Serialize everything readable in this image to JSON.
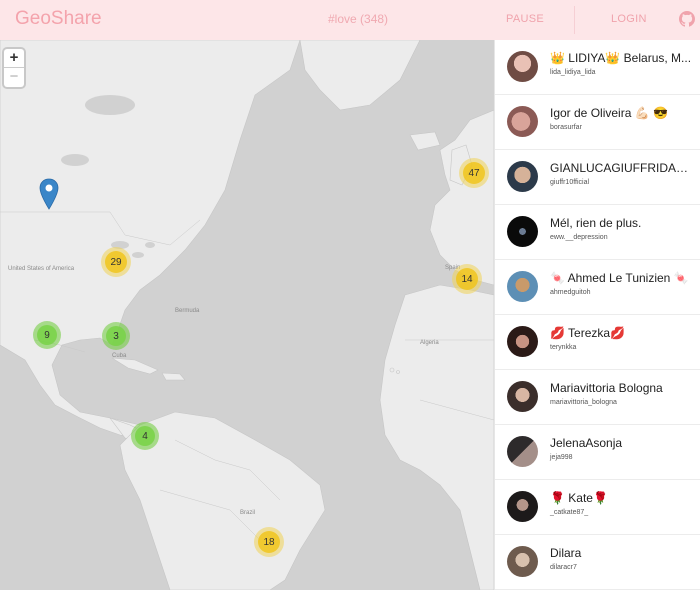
{
  "app": {
    "title": "GeoShare"
  },
  "header": {
    "tag": "#love (348)",
    "pause_label": "PAUSE",
    "login_label": "LOGIN",
    "github_icon": "github-icon"
  },
  "map": {
    "zoom_in": "+",
    "zoom_out": "−",
    "clusters": [
      {
        "count": "47",
        "color": "yellow"
      },
      {
        "count": "29",
        "color": "yellow"
      },
      {
        "count": "14",
        "color": "yellow"
      },
      {
        "count": "18",
        "color": "yellow"
      },
      {
        "count": "9",
        "color": "green"
      },
      {
        "count": "3",
        "color": "green"
      },
      {
        "count": "4",
        "color": "green"
      }
    ],
    "labels": {
      "us": "United States of America",
      "bermuda": "Bermuda",
      "cuba": "Cuba",
      "spain": "Spain",
      "algeria": "Algeria",
      "brazil": "Brazil"
    }
  },
  "users": [
    {
      "name": "👑 LIDIYA👑 Belarus, M...",
      "handle": "lida_lidiya_lida"
    },
    {
      "name": "Igor de Oliveira 💪🏻 😎",
      "handle": "borasurfar"
    },
    {
      "name": "GIANLUCAGIUFFRIDAO...",
      "handle": "giuffr10fficial"
    },
    {
      "name": "Mél, rien de plus.",
      "handle": "eww.__depression"
    },
    {
      "name": "🍬 Ahmed Le Tunizien 🍬",
      "handle": "ahmedguitoh"
    },
    {
      "name": "💋 Terezka💋",
      "handle": "terynkka"
    },
    {
      "name": "Mariavittoria Bologna",
      "handle": "mariavittoria_bologna"
    },
    {
      "name": "JelenaAsonja",
      "handle": "jeja998"
    },
    {
      "name": "🌹 Kate🌹",
      "handle": "_catkate87_"
    },
    {
      "name": "Dilara",
      "handle": "dilaracr7"
    }
  ],
  "colors": {
    "header_bg": "#fde6e8",
    "accent": "#f4a3ac",
    "map_water": "#d1d1d1",
    "map_land": "#ececec",
    "cluster_yellow": "#f0c20c",
    "cluster_green": "#78d246",
    "marker": "#3a86c8"
  }
}
